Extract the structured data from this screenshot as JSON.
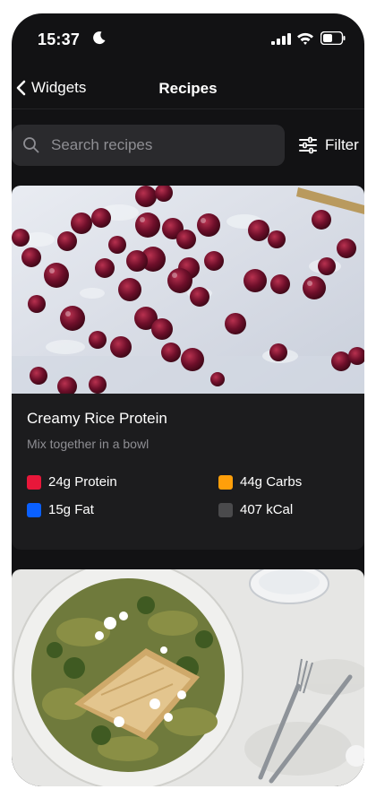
{
  "status_bar": {
    "time": "15:37"
  },
  "nav": {
    "back_label": "Widgets",
    "title": "Recipes"
  },
  "search": {
    "placeholder": "Search recipes",
    "filter_label": "Filter"
  },
  "recipes": [
    {
      "title": "Creamy Rice Protein",
      "description": "Mix together in a bowl",
      "macros": {
        "protein": {
          "label": "24g Protein",
          "color": "#e8173a"
        },
        "carbs": {
          "label": "44g Carbs",
          "color": "#ff9f0a"
        },
        "fat": {
          "label": "15g Fat",
          "color": "#0a60ff"
        },
        "calories": {
          "label": "407 kCal",
          "color": "#4a4a4c"
        }
      }
    },
    {
      "title": "",
      "description": ""
    }
  ]
}
